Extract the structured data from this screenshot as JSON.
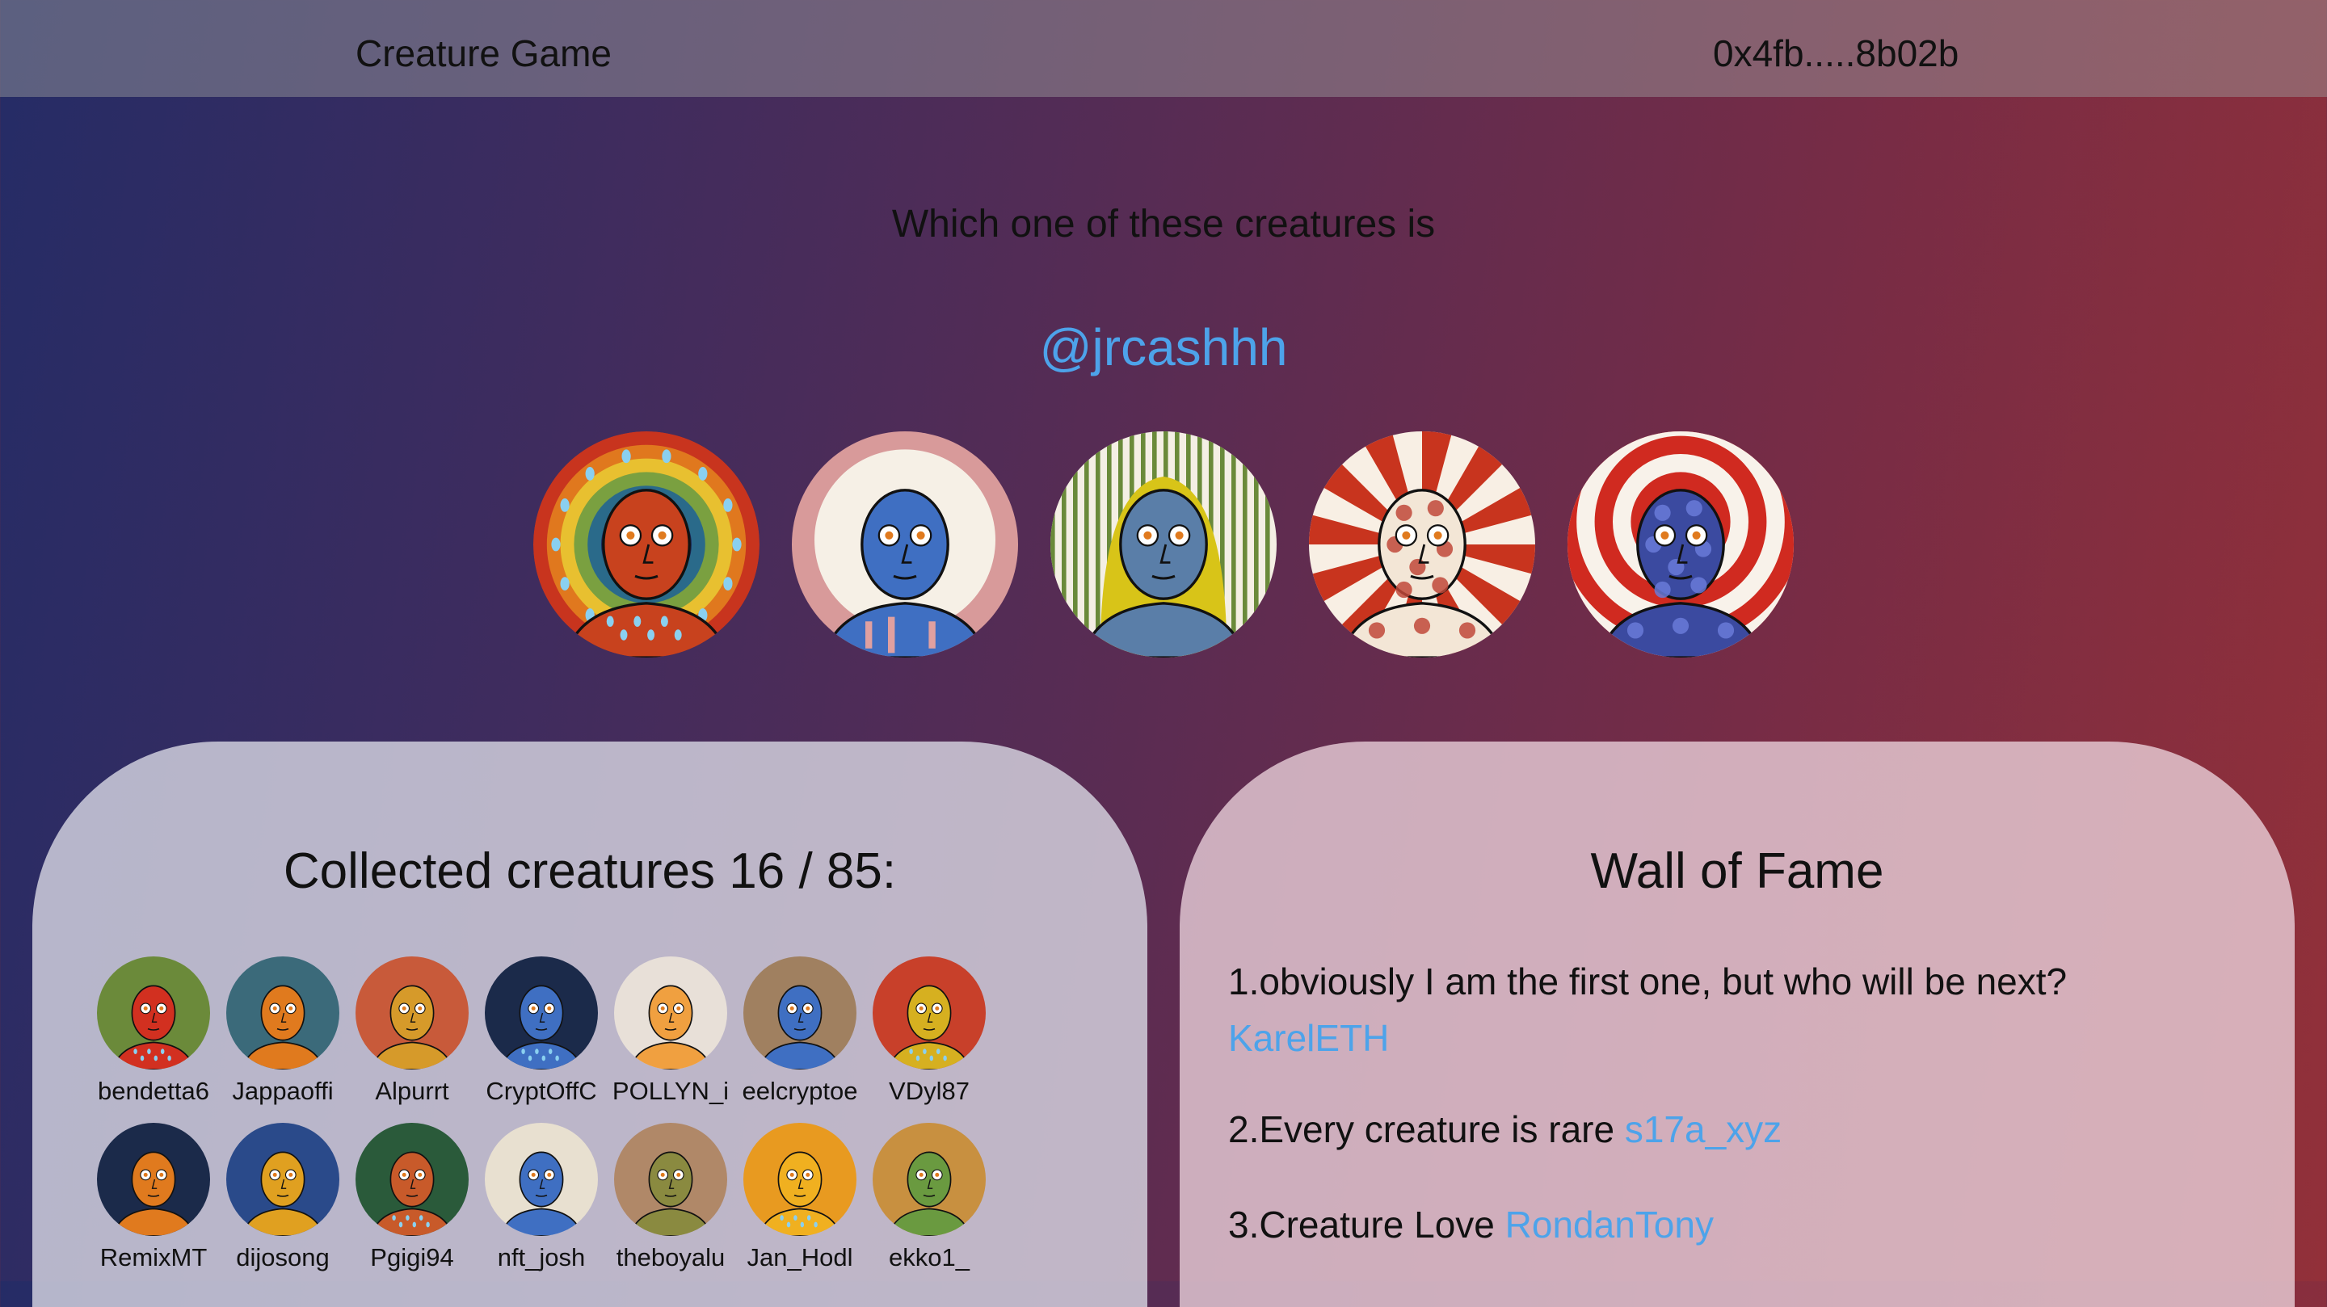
{
  "header": {
    "app_title": "Creature Game",
    "wallet_address": "0x4fb.....8b02b"
  },
  "challenge": {
    "question": "Which one of these creatures is",
    "target_handle": "@jrcashhh"
  },
  "choices": [
    {
      "background": "halo-rainbow",
      "skin": "#c8421e",
      "pattern": "raindrops"
    },
    {
      "background": "white-cloud",
      "skin": "#3f6fc2",
      "pattern": "drips"
    },
    {
      "background": "striped-hood",
      "skin": "#5a7ea8",
      "pattern": "yellow-hood"
    },
    {
      "background": "red-sunburst",
      "skin": "#f3e6d6",
      "pattern": "red-dots"
    },
    {
      "background": "red-target-rings",
      "skin": "#3b4aa0",
      "pattern": "blue-dots"
    }
  ],
  "collection": {
    "title": "Collected creatures 16 / 85:",
    "items": [
      {
        "name": "bendetta6",
        "bg": "#6b8a3a",
        "skin": "#d23020"
      },
      {
        "name": "Jappaoffi",
        "bg": "#3b6a7a",
        "skin": "#e07a1e"
      },
      {
        "name": "Alpurrt",
        "bg": "#c85a3a",
        "skin": "#d69a2a"
      },
      {
        "name": "CryptOffC",
        "bg": "#1b2a4a",
        "skin": "#3f6fc2"
      },
      {
        "name": "POLLYN_i",
        "bg": "#e8e0d8",
        "skin": "#f0a040"
      },
      {
        "name": "eelcryptoe",
        "bg": "#a08060",
        "skin": "#3f6fc2"
      },
      {
        "name": "VDyl87",
        "bg": "#c8402a",
        "skin": "#d6b020"
      },
      {
        "name": "RemixMT",
        "bg": "#1b2a4a",
        "skin": "#e07a1e"
      },
      {
        "name": "dijosong",
        "bg": "#2a4a8a",
        "skin": "#e0a020"
      },
      {
        "name": "Pgigi94",
        "bg": "#2a5a3a",
        "skin": "#c85a2a"
      },
      {
        "name": "nft_josh",
        "bg": "#e8e0d0",
        "skin": "#3f6fc2"
      },
      {
        "name": "theboyalu",
        "bg": "#b08868",
        "skin": "#8a8a40"
      },
      {
        "name": "Jan_Hodl",
        "bg": "#e89a20",
        "skin": "#f0b020"
      },
      {
        "name": "ekko1_",
        "bg": "#c89040",
        "skin": "#6a9a40"
      }
    ]
  },
  "wall_of_fame": {
    "title": "Wall of Fame",
    "entries": [
      {
        "text": "1.obviously I am the first one, but who will be next?",
        "user": "KarelETH"
      },
      {
        "text": "2.Every creature is rare",
        "user": "s17a_xyz"
      },
      {
        "text": "3.Creature Love",
        "user": "RondanTony"
      }
    ]
  }
}
